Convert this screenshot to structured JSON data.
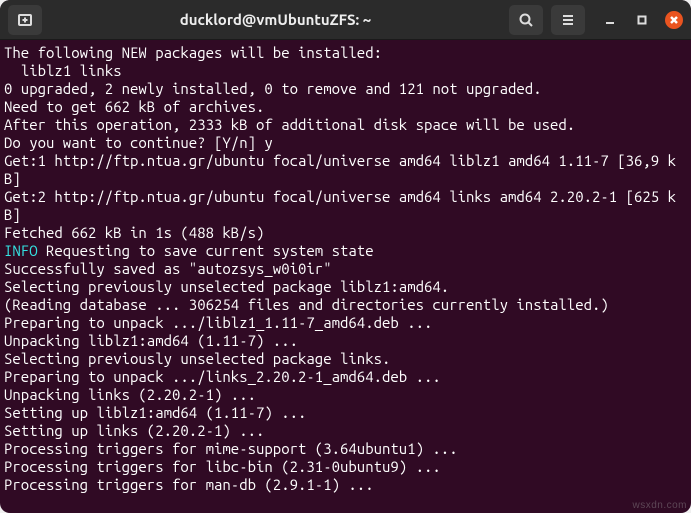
{
  "titlebar": {
    "title": "ducklord@vmUbuntuZFS: ~"
  },
  "terminal": {
    "lines": [
      {
        "text": "The following NEW packages will be installed:"
      },
      {
        "text": "  liblz1 links"
      },
      {
        "text": "0 upgraded, 2 newly installed, 0 to remove and 121 not upgraded."
      },
      {
        "text": "Need to get 662 kB of archives."
      },
      {
        "text": "After this operation, 2333 kB of additional disk space will be used."
      },
      {
        "text": "Do you want to continue? [Y/n] y"
      },
      {
        "text": "Get:1 http://ftp.ntua.gr/ubuntu focal/universe amd64 liblz1 amd64 1.11-7 [36,9 kB]"
      },
      {
        "text": "Get:2 http://ftp.ntua.gr/ubuntu focal/universe amd64 links amd64 2.20.2-1 [625 kB]"
      },
      {
        "text": "Fetched 662 kB in 1s (488 kB/s)"
      },
      {
        "spans": [
          {
            "text": "INFO",
            "class": "info"
          },
          {
            "text": " Requesting to save current system state"
          }
        ]
      },
      {
        "text": "Successfully saved as \"autozsys_w0i0ir\""
      },
      {
        "text": "Selecting previously unselected package liblz1:amd64."
      },
      {
        "text": "(Reading database ... 306254 files and directories currently installed.)"
      },
      {
        "text": "Preparing to unpack .../liblz1_1.11-7_amd64.deb ..."
      },
      {
        "text": "Unpacking liblz1:amd64 (1.11-7) ..."
      },
      {
        "text": "Selecting previously unselected package links."
      },
      {
        "text": "Preparing to unpack .../links_2.20.2-1_amd64.deb ..."
      },
      {
        "text": "Unpacking links (2.20.2-1) ..."
      },
      {
        "text": "Setting up liblz1:amd64 (1.11-7) ..."
      },
      {
        "text": "Setting up links (2.20.2-1) ..."
      },
      {
        "text": "Processing triggers for mime-support (3.64ubuntu1) ..."
      },
      {
        "text": "Processing triggers for libc-bin (2.31-0ubuntu9) ..."
      },
      {
        "text": "Processing triggers for man-db (2.9.1-1) ..."
      }
    ]
  },
  "watermark": "wsxdn.com"
}
